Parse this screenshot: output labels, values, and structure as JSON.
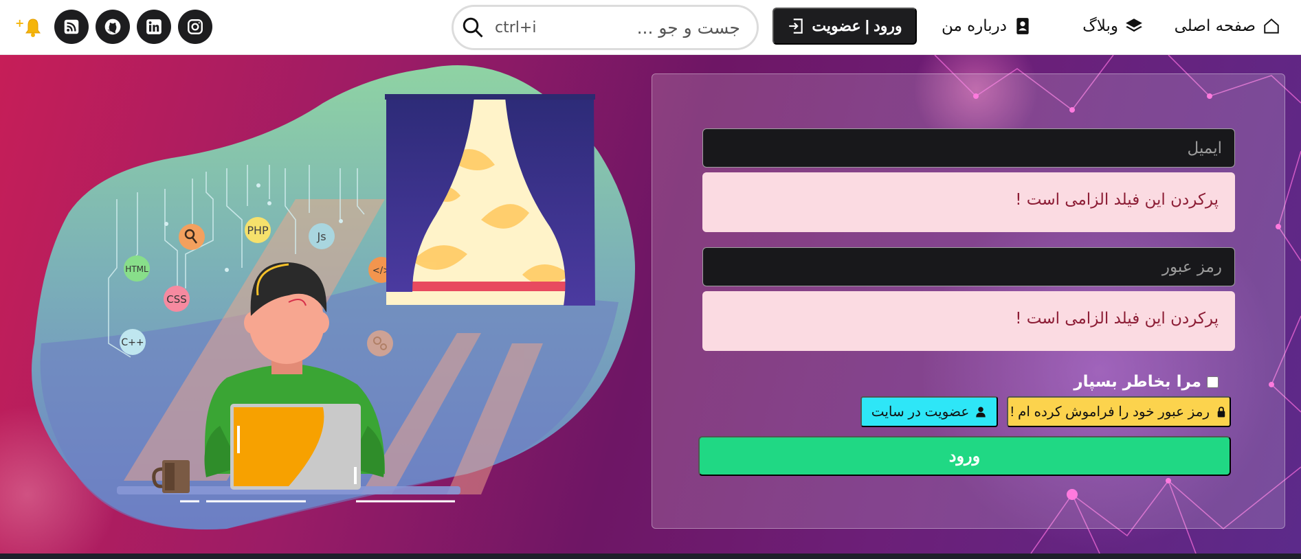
{
  "header": {
    "nav": [
      {
        "label": "صفحه اصلی",
        "icon": "home-icon"
      },
      {
        "label": "وبلاگ",
        "icon": "layers-icon"
      },
      {
        "label": "درباره من",
        "icon": "contact-card-icon"
      }
    ],
    "login_button": {
      "label": "ورود | عضویت",
      "icon": "sign-in-icon"
    },
    "search": {
      "placeholder": "جست و جو ...",
      "shortcut": "ctrl+i"
    },
    "socials": [
      {
        "name": "instagram-icon"
      },
      {
        "name": "linkedin-icon"
      },
      {
        "name": "github-icon"
      },
      {
        "name": "rss-icon"
      }
    ],
    "notification": {
      "icon": "bell-icon",
      "badge": "+"
    }
  },
  "illustration": {
    "bubbles": [
      "PHP",
      "Js",
      "HTML",
      "CSS",
      "C++",
      "</>"
    ]
  },
  "form": {
    "email_placeholder": "ایمیل",
    "email_error": "پرکردن این فیلد الزامی است !",
    "password_placeholder": "رمز عبور",
    "password_error": "پرکردن این فیلد الزامی است !",
    "remember_label": "مرا بخاطر بسپار",
    "remember_checked": false,
    "forgot_label": "رمز عبور خود را فراموش کرده ام !",
    "signup_label": "عضویت در سایت",
    "submit_label": "ورود"
  },
  "colors": {
    "accent_dark": "#1d1d1f",
    "submit_green": "#20d884",
    "forgot_yellow": "#fcd34d",
    "signup_cyan": "#2ee6f7",
    "alert_bg": "#fbdbe2",
    "alert_text": "#8c1d35"
  }
}
